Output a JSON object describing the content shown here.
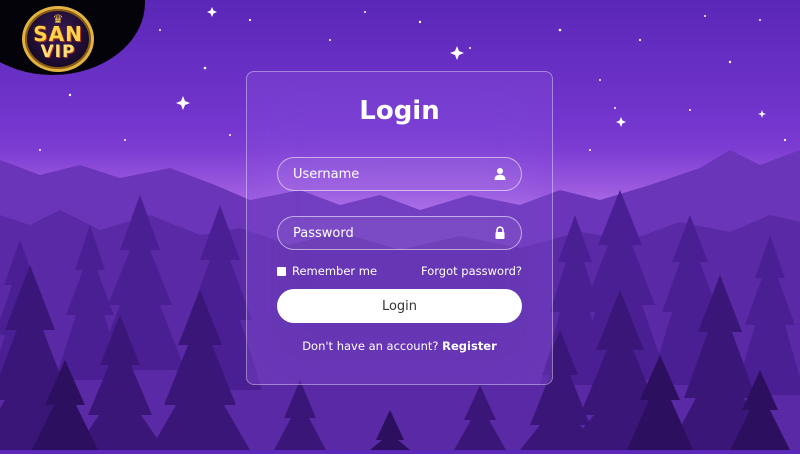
{
  "brand": {
    "logo_line1": "SAN",
    "logo_line2": "VIP"
  },
  "login": {
    "title": "Login",
    "username_placeholder": "Username",
    "password_placeholder": "Password",
    "remember_label": "Remember me",
    "forgot_label": "Forgot password?",
    "submit_label": "Login",
    "register_prompt": "Don't have an account?",
    "register_label": "Register"
  },
  "icons": {
    "username": "user-icon",
    "password": "lock-icon"
  },
  "colors": {
    "accent": "#7a3fcf",
    "button_bg": "#ffffff",
    "text": "#ffffff"
  }
}
